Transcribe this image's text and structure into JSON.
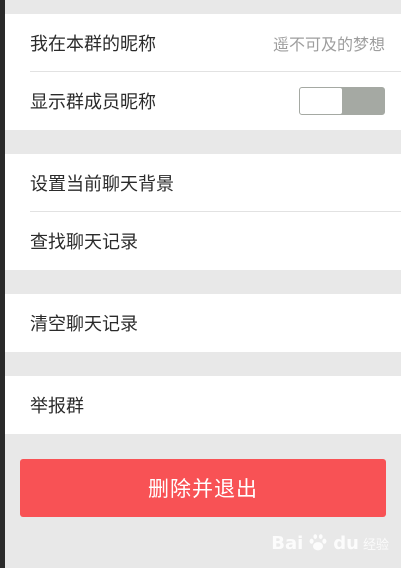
{
  "settings": {
    "group_nickname": {
      "label": "我在本群的昵称",
      "value": "遥不可及的梦想"
    },
    "show_member_nicknames": {
      "label": "显示群成员昵称",
      "enabled": false
    },
    "set_background": {
      "label": "设置当前聊天背景"
    },
    "search_history": {
      "label": "查找聊天记录"
    },
    "clear_history": {
      "label": "清空聊天记录"
    },
    "report_group": {
      "label": "举报群"
    }
  },
  "actions": {
    "delete_and_exit": "删除并退出"
  },
  "watermark": {
    "brand": "Bai",
    "brand2": "du",
    "site": "经验"
  },
  "colors": {
    "danger": "#f85255",
    "toggle_off": "#a5a9a3"
  }
}
